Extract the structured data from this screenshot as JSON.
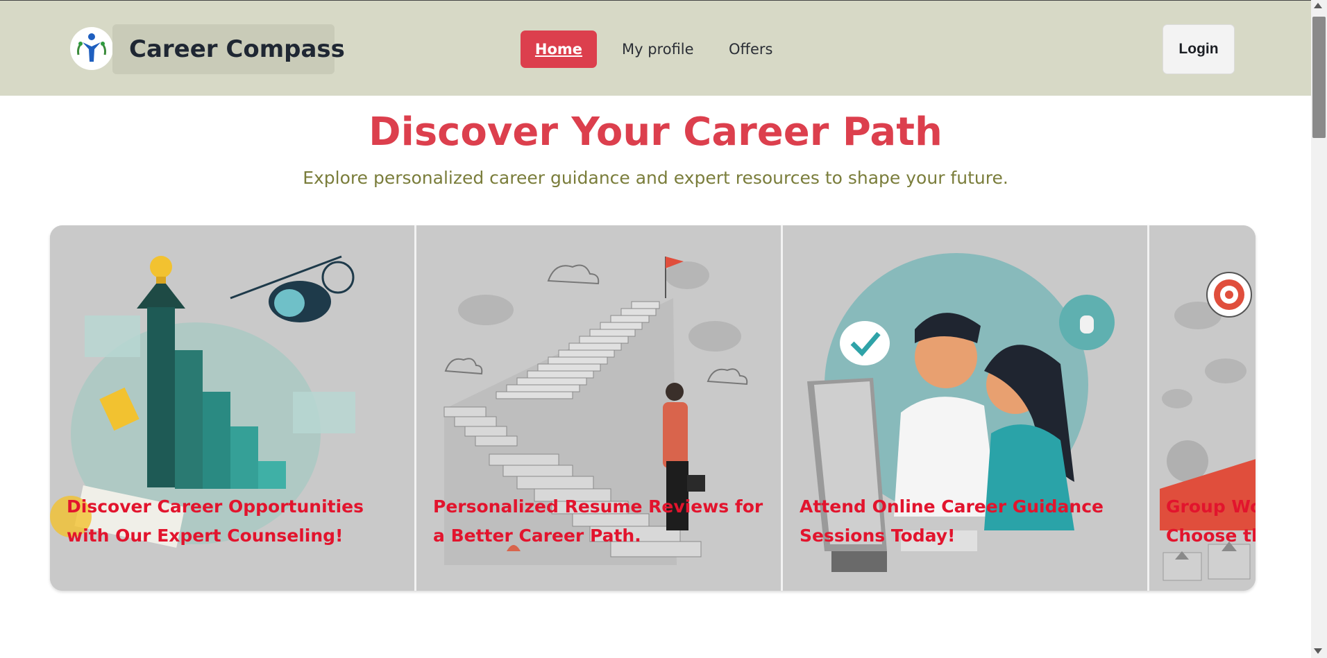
{
  "header": {
    "brand": "Career Compass",
    "nav": {
      "home": "Home",
      "profile": "My profile",
      "offers": "Offers"
    },
    "login": "Login"
  },
  "hero": {
    "title": "Discover Your Career Path",
    "subtitle": "Explore personalized career guidance and expert resources to shape your future."
  },
  "carousel": {
    "cards": [
      {
        "caption": "Discover Career Opportunities with Our Expert Counseling!",
        "icon": "career-growth-illustration"
      },
      {
        "caption": "Personalized Resume Reviews for a Better Career Path.",
        "icon": "staircase-illustration"
      },
      {
        "caption": "Attend Online Career Guidance Sessions Today!",
        "icon": "online-session-illustration"
      },
      {
        "caption": "Group Workshops to Help You Choose the Right Path.",
        "icon": "workshop-illustration"
      }
    ]
  },
  "colors": {
    "accent": "#dc3f4d",
    "navbar": "#d7d9c6",
    "subtitle": "#7a7d3b",
    "caption": "#e2142d"
  }
}
